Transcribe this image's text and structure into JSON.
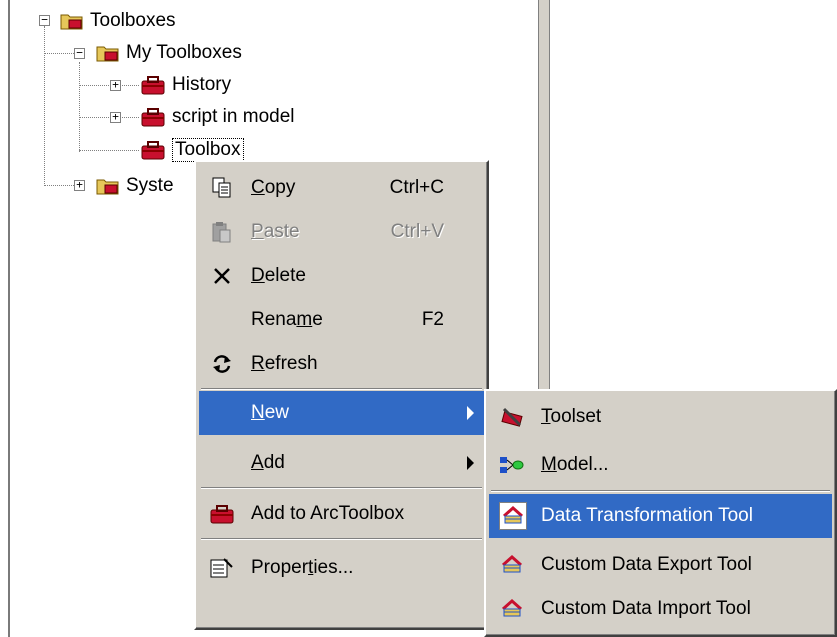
{
  "tree": {
    "root": "Toolboxes",
    "my_toolboxes": "My Toolboxes",
    "children": [
      "History",
      "script in model",
      "Toolbox"
    ],
    "system": "Syste"
  },
  "context_menu": {
    "copy": {
      "pre": "",
      "key": "C",
      "post": "opy",
      "shortcut": "Ctrl+C"
    },
    "paste": {
      "pre": "",
      "key": "P",
      "post": "aste",
      "shortcut": "Ctrl+V"
    },
    "delete": {
      "pre": "",
      "key": "D",
      "post": "elete"
    },
    "rename": {
      "pre": "Rena",
      "key": "m",
      "post": "e",
      "shortcut": "F2"
    },
    "refresh": {
      "pre": "",
      "key": "R",
      "post": "efresh"
    },
    "new": {
      "pre": "",
      "key": "N",
      "post": "ew"
    },
    "add": {
      "pre": "",
      "key": "A",
      "post": "dd"
    },
    "add_to_arctoolbox": "Add to ArcToolbox",
    "properties": {
      "pre": "Proper",
      "key": "t",
      "post": "ies..."
    }
  },
  "new_submenu": {
    "toolset": {
      "pre": "",
      "key": "T",
      "post": "oolset"
    },
    "model": {
      "pre": "",
      "key": "M",
      "post": "odel..."
    },
    "data_transformation_tool": "Data Transformation Tool",
    "custom_data_export_tool": "Custom Data Export Tool",
    "custom_data_import_tool": "Custom Data Import Tool"
  },
  "colors": {
    "highlight": "#316ac5",
    "menu_bg": "#d4d0c8",
    "toolbox_red": "#c8102e"
  }
}
